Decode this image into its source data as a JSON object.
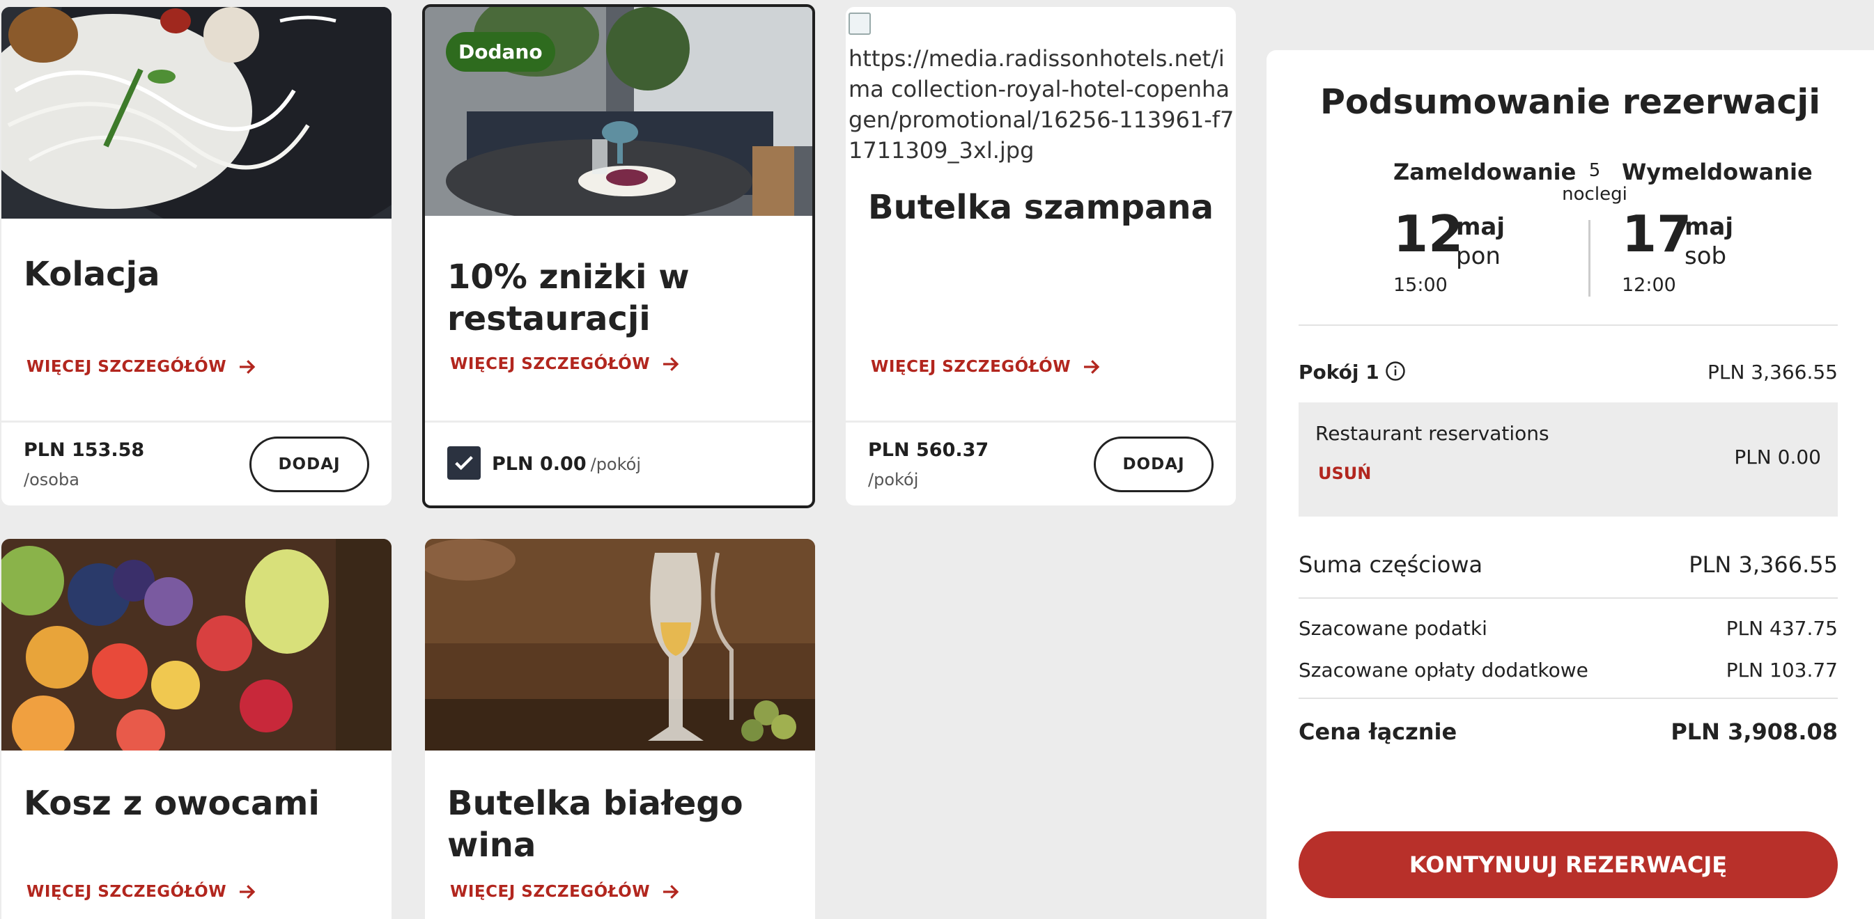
{
  "cards": [
    {
      "title": "Kolacja",
      "link": "WIĘCEJ SZCZEGÓŁÓW",
      "price": "PLN 153.58",
      "unit": "/osoba",
      "button": "DODAJ"
    },
    {
      "badge": "Dodano",
      "title": "10% zniżki w restauracji",
      "link": "WIĘCEJ SZCZEGÓŁÓW",
      "price": "PLN 0.00",
      "unit": "/pokój"
    },
    {
      "image_alt": "https://media.radissonhotels.net/ima collection-royal-hotel-copenhagen/promotional/16256-113961-f71711309_3xl.jpg",
      "title": "Butelka szampana",
      "link": "WIĘCEJ SZCZEGÓŁÓW",
      "price": "PLN 560.37",
      "unit": "/pokój",
      "button": "DODAJ"
    },
    {
      "title": "Kosz z owocami",
      "link": "WIĘCEJ SZCZEGÓŁÓW"
    },
    {
      "title": "Butelka białego wina",
      "link": "WIĘCEJ SZCZEGÓŁÓW"
    }
  ],
  "summary": {
    "title": "Podsumowanie rezerwacji",
    "checkin_label": "Zameldowanie",
    "checkout_label": "Wymeldowanie",
    "nights_count": "5",
    "nights_label": "noclegi",
    "checkin": {
      "day": "12",
      "month": "maj",
      "weekday": "pon",
      "time": "15:00"
    },
    "checkout": {
      "day": "17",
      "month": "maj",
      "weekday": "sob",
      "time": "12:00"
    },
    "room_label": "Pokój 1",
    "room_price": "PLN 3,366.55",
    "addon_name": "Restaurant reservations",
    "addon_price": "PLN 0.00",
    "addon_remove": "USUŃ",
    "subtotal_label": "Suma częściowa",
    "subtotal_value": "PLN 3,366.55",
    "taxes_label": "Szacowane podatki",
    "taxes_value": "PLN 437.75",
    "fees_label": "Szacowane opłaty dodatkowe",
    "fees_value": "PLN 103.77",
    "total_label": "Cena łącznie",
    "total_value": "PLN 3,908.08",
    "continue_button": "KONTYNUUJ REZERWACJĘ"
  },
  "colors": {
    "accent": "#b8302a",
    "link": "#b2261e",
    "badge": "#2e6b1e",
    "checkbox": "#2b3240"
  }
}
